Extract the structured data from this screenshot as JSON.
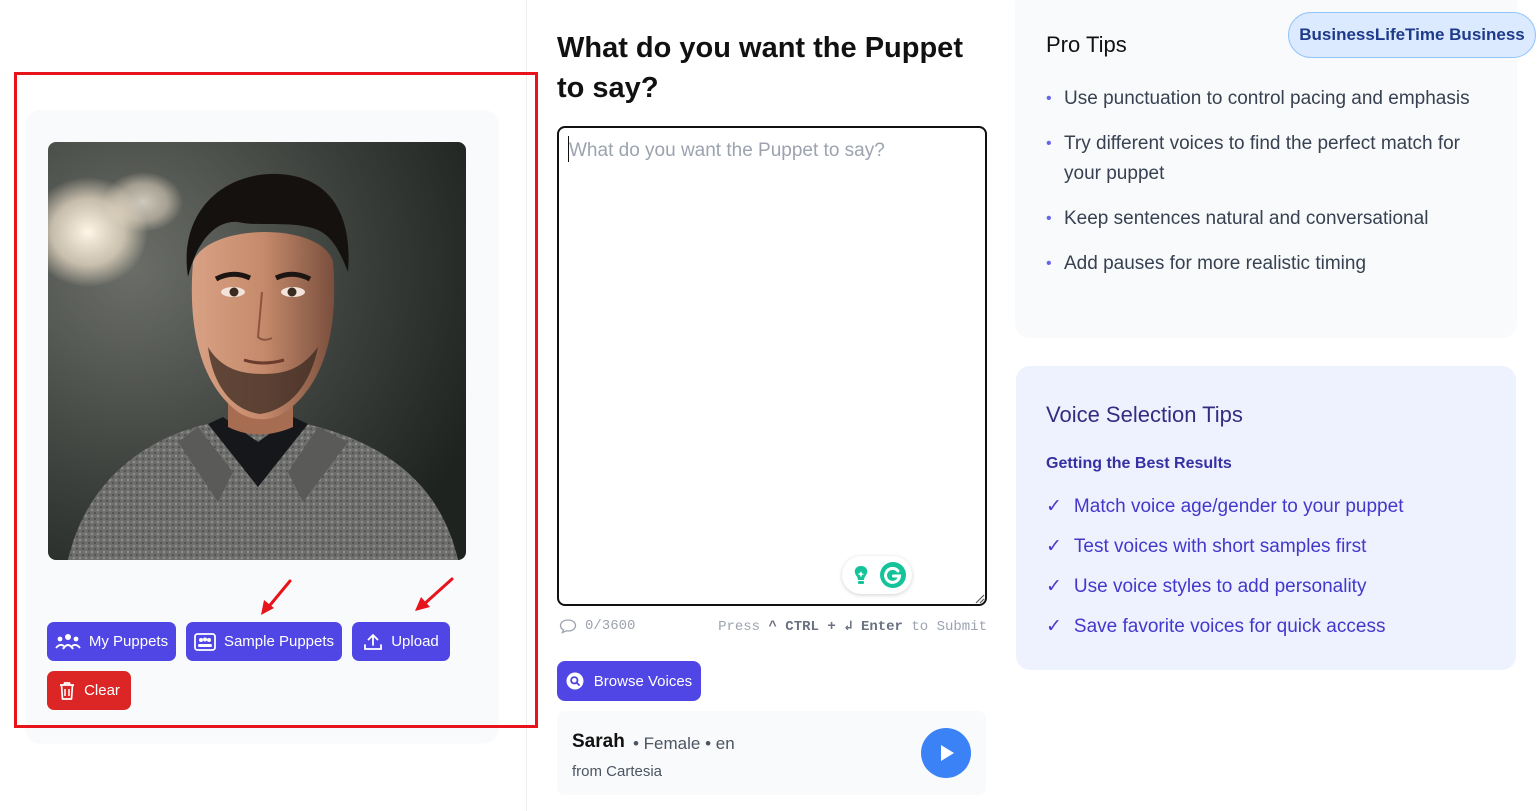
{
  "puppet_panel": {
    "buttons": {
      "my_puppets": "My Puppets",
      "sample_puppets": "Sample Puppets",
      "upload": "Upload",
      "clear": "Clear"
    }
  },
  "editor": {
    "heading": "What do you want the Puppet to say?",
    "placeholder": "What do you want the Puppet to say?",
    "value": "",
    "char_count": "0/3600",
    "shortcut": {
      "press": "Press",
      "ctrl": "^ CTRL",
      "plus": "+",
      "enter": "↲ Enter",
      "to_submit": "to Submit"
    }
  },
  "voice": {
    "browse_label": "Browse Voices",
    "name": "Sarah",
    "meta": "• Female  •  en",
    "provider": "from Cartesia"
  },
  "badge": "BusinessLifeTime Business",
  "pro_tips": {
    "title": "Pro Tips",
    "items": [
      "Use punctuation to control pacing and emphasis",
      "Try different voices to find the perfect match for your puppet",
      "Keep sentences natural and conversational",
      "Add pauses for more realistic timing"
    ]
  },
  "voice_tips": {
    "title": "Voice Selection Tips",
    "subtitle": "Getting the Best Results",
    "check_symbol": "✓",
    "items": [
      "Match voice age/gender to your puppet",
      "Test voices with short samples first",
      "Use voice styles to add personality",
      "Save favorite voices for quick access"
    ]
  },
  "colors": {
    "accent": "#4f46e5",
    "danger": "#dc2626",
    "highlight_annotation": "#e8141c",
    "play": "#3b82f6"
  }
}
